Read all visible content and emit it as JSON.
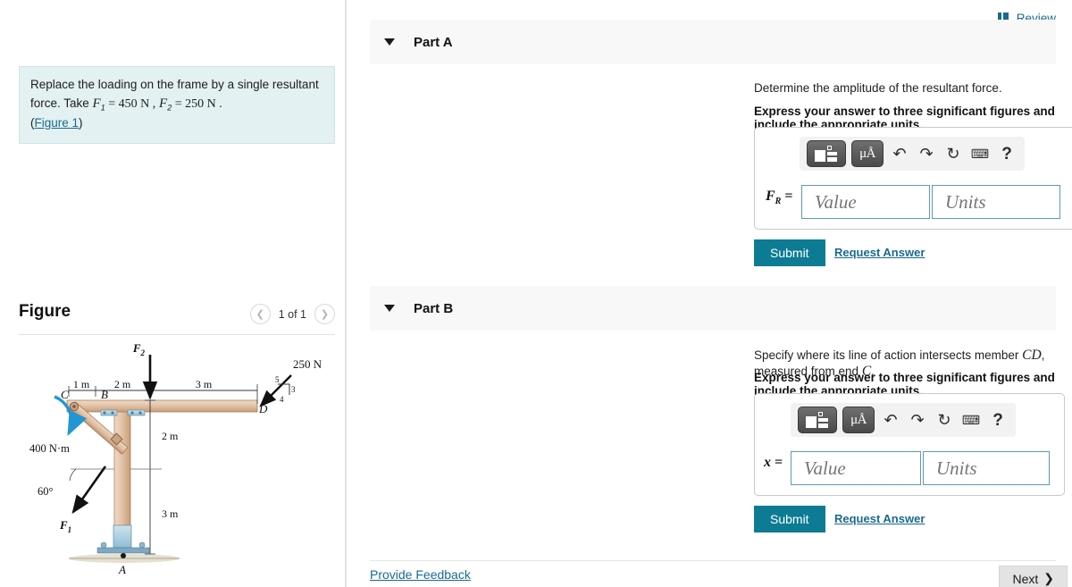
{
  "problem": {
    "line1_a": "Replace the loading on the frame by a single resultant",
    "line1_b": "force. Take ",
    "f1_var": "F",
    "f1_sub": "1",
    "f1_eq": " = 450 N ,",
    "f2_var": "F",
    "f2_sub": "2",
    "f2_eq": " = 250 N .",
    "figure_link": "Figure 1",
    "paren_open": "(",
    "paren_close": ")"
  },
  "header": {
    "review_label": "Review",
    "review_icon": "book-icon"
  },
  "figure_panel": {
    "title": "Figure",
    "counter": "1 of 1",
    "prev_icon": "chevron-left-icon",
    "next_icon": "chevron-right-icon"
  },
  "figure_diagram": {
    "label_F2": "F",
    "label_F2_sub": "2",
    "label_F1": "F",
    "label_F1_sub": "1",
    "label_250N": "250 N",
    "label_400Nm": "400 N·m",
    "label_60deg": "60°",
    "dim_1m": "1 m",
    "dim_2m_top": "2 m",
    "dim_3m_top": "3 m",
    "dim_2m_vert": "2 m",
    "dim_3m_vert": "3 m",
    "node_A": "A",
    "node_B": "B",
    "node_C": "C",
    "node_D": "D",
    "slope_5": "5",
    "slope_3": "3",
    "slope_4": "4",
    "colors": {
      "wood_light": "#e8cdb6",
      "wood_mid": "#d9b494",
      "wood_dark": "#b98d68",
      "moment_blue": "#2196d6",
      "support_blue": "#a8cfe0",
      "ground": "#e5e0cf"
    }
  },
  "part_a": {
    "caret_icon": "caret-down-icon",
    "label": "Part A",
    "question": "Determine the amplitude of the resultant force.",
    "instruction": "Express your answer to three significant figures and include the appropriate units.",
    "variable": "F",
    "variable_sub": "R",
    "equals": "=",
    "value_placeholder": "Value",
    "units_placeholder": "Units",
    "value_current": "",
    "units_current": "",
    "submit_label": "Submit",
    "request_label": "Request Answer",
    "toolbar": {
      "template_icon": "math-template-icon",
      "units_icon": "units-mu-angstrom-icon",
      "units_label": "μÅ",
      "undo_icon": "undo-icon",
      "redo_icon": "redo-icon",
      "reset_icon": "reset-icon",
      "keyboard_icon": "keyboard-icon",
      "help_icon": "help-icon",
      "help_label": "?"
    }
  },
  "part_b": {
    "caret_icon": "caret-down-icon",
    "label": "Part B",
    "question_pre": "Specify where its line of action intersects member ",
    "question_cd": "CD",
    "question_mid": ", measured from end ",
    "question_c": "C",
    "question_end": ".",
    "instruction": "Express your answer to three significant figures and include the appropriate units.",
    "variable": "x",
    "equals": "=",
    "value_placeholder": "Value",
    "units_placeholder": "Units",
    "value_current": "",
    "units_current": "",
    "submit_label": "Submit",
    "request_label": "Request Answer",
    "toolbar": {
      "template_icon": "math-template-icon",
      "units_icon": "units-mu-angstrom-icon",
      "units_label": "μÅ",
      "undo_icon": "undo-icon",
      "redo_icon": "redo-icon",
      "reset_icon": "reset-icon",
      "keyboard_icon": "keyboard-icon",
      "help_icon": "help-icon",
      "help_label": "?"
    }
  },
  "footer": {
    "feedback_label": "Provide Feedback",
    "next_label": "Next",
    "next_icon": "chevron-right-icon"
  },
  "theme": {
    "accent_teal": "#0c7b93",
    "link_blue": "#1a6a8f",
    "problem_bg": "#e3f1f2",
    "part_header_bg": "#f8f8f8",
    "input_border": "#5b9bb5"
  }
}
